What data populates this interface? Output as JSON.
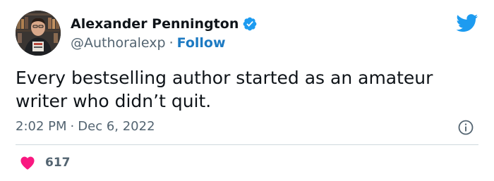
{
  "author": {
    "display_name": "Alexander Pennington",
    "handle": "@Authoralexp",
    "separator": "·",
    "follow_label": "Follow",
    "verified": true
  },
  "tweet": {
    "text": "Every bestselling author started as an amateur writer who didn’t quit.",
    "time": "2:02 PM",
    "separator": "·",
    "date": "Dec 6, 2022"
  },
  "engagement": {
    "likes": "617"
  },
  "icons": {
    "brand": "twitter-bird-icon",
    "verified": "verified-badge-icon",
    "info": "info-icon",
    "like": "heart-icon"
  },
  "colors": {
    "brand_blue": "#1d9bf0",
    "follow_blue": "#1d7ac2",
    "heart_pink": "#f91880",
    "secondary_text": "#536471",
    "primary_text": "#0f1419",
    "divider": "#cfd9de"
  }
}
